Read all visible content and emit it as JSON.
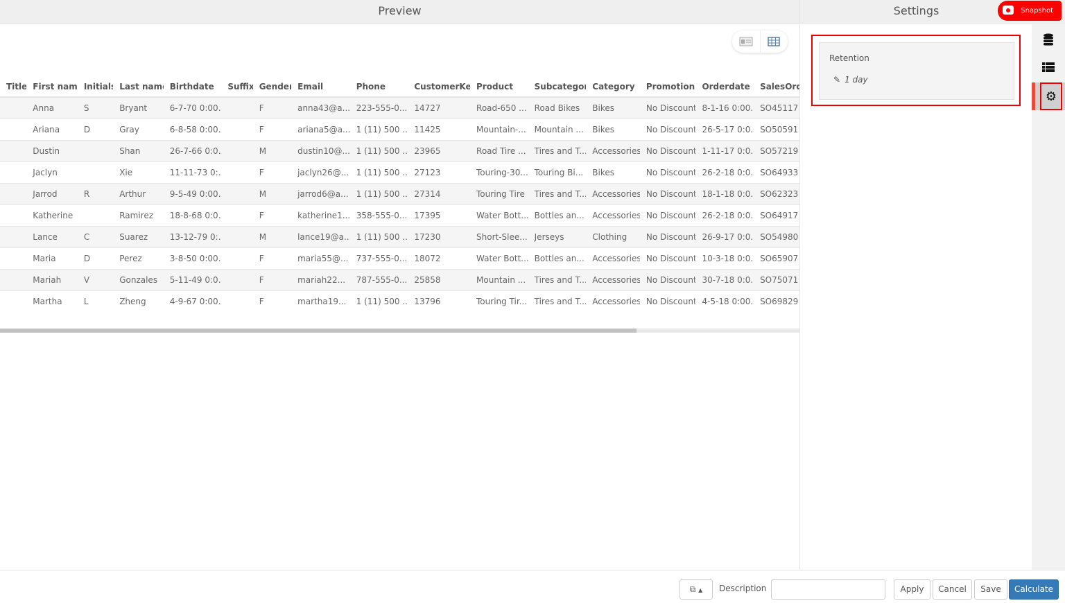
{
  "preview": {
    "title": "Preview"
  },
  "settings": {
    "title": "Settings",
    "snapshot_label": "Snapshot",
    "retention_label": "Retention",
    "retention_value": "1 day"
  },
  "colors": {
    "accent": "#337ab7",
    "snapshot": "#ff0000",
    "highlight": "#e00000"
  },
  "table": {
    "columns": [
      "Title",
      "First name",
      "Initials",
      "Last name",
      "Birthdate",
      "Suffix",
      "Gender",
      "Email",
      "Phone",
      "CustomerKey",
      "Product",
      "Subcategory",
      "Category",
      "Promotion",
      "Orderdate",
      "SalesOrderI"
    ],
    "rows": [
      [
        "",
        "Anna",
        "S",
        "Bryant",
        "6-7-70 0:00...",
        "",
        "F",
        "anna43@a...",
        "223-555-0...",
        "14727",
        "Road-650 ...",
        "Road Bikes",
        "Bikes",
        "No Discount",
        "8-1-16 0:00...",
        "SO45117"
      ],
      [
        "",
        "Ariana",
        "D",
        "Gray",
        "6-8-58 0:00...",
        "",
        "F",
        "ariana5@a...",
        "1 (11) 500 ...",
        "11425",
        "Mountain-...",
        "Mountain ...",
        "Bikes",
        "No Discount",
        "26-5-17 0:0...",
        "SO50591"
      ],
      [
        "",
        "Dustin",
        "",
        "Shan",
        "26-7-66 0:0...",
        "",
        "M",
        "dustin10@...",
        "1 (11) 500 ...",
        "23965",
        "Road Tire ...",
        "Tires and T...",
        "Accessories",
        "No Discount",
        "1-11-17 0:0...",
        "SO57219"
      ],
      [
        "",
        "Jaclyn",
        "",
        "Xie",
        "11-11-73 0:...",
        "",
        "F",
        "jaclyn26@...",
        "1 (11) 500 ...",
        "27123",
        "Touring-30...",
        "Touring Bi...",
        "Bikes",
        "No Discount",
        "26-2-18 0:0...",
        "SO64933"
      ],
      [
        "",
        "Jarrod",
        "R",
        "Arthur",
        "9-5-49 0:00...",
        "",
        "M",
        "jarrod6@a...",
        "1 (11) 500 ...",
        "27314",
        "Touring Tire",
        "Tires and T...",
        "Accessories",
        "No Discount",
        "18-1-18 0:0...",
        "SO62323"
      ],
      [
        "",
        "Katherine",
        "",
        "Ramirez",
        "18-8-68 0:0...",
        "",
        "F",
        "katherine1...",
        "358-555-0...",
        "17395",
        "Water Bott...",
        "Bottles an...",
        "Accessories",
        "No Discount",
        "26-2-18 0:0...",
        "SO64917"
      ],
      [
        "",
        "Lance",
        "C",
        "Suarez",
        "13-12-79 0:...",
        "",
        "M",
        "lance19@a...",
        "1 (11) 500 ...",
        "17230",
        "Short-Slee...",
        "Jerseys",
        "Clothing",
        "No Discount",
        "26-9-17 0:0...",
        "SO54980"
      ],
      [
        "",
        "Maria",
        "D",
        "Perez",
        "3-8-50 0:00...",
        "",
        "F",
        "maria55@...",
        "737-555-0...",
        "18072",
        "Water Bott...",
        "Bottles an...",
        "Accessories",
        "No Discount",
        "10-3-18 0:0...",
        "SO65907"
      ],
      [
        "",
        "Mariah",
        "V",
        "Gonzales",
        "5-11-49 0:0...",
        "",
        "F",
        "mariah22...",
        "787-555-0...",
        "25858",
        "Mountain ...",
        "Tires and T...",
        "Accessories",
        "No Discount",
        "30-7-18 0:0...",
        "SO75071"
      ],
      [
        "",
        "Martha",
        "L",
        "Zheng",
        "4-9-67 0:00...",
        "",
        "F",
        "martha19...",
        "1 (11) 500 ...",
        "13796",
        "Touring Tir...",
        "Tires and T...",
        "Accessories",
        "No Discount",
        "4-5-18 0:00...",
        "SO69829"
      ]
    ]
  },
  "footer": {
    "description_label": "Description",
    "description_value": "",
    "apply": "Apply",
    "cancel": "Cancel",
    "save": "Save",
    "calculate": "Calculate"
  }
}
